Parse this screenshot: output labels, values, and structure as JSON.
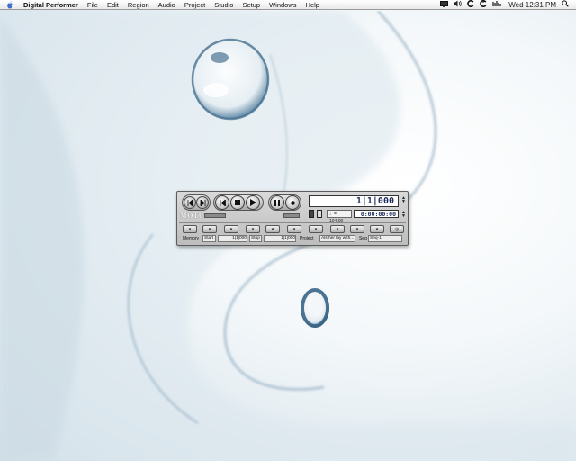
{
  "menubar": {
    "app_name": "Digital Performer",
    "items": [
      "File",
      "Edit",
      "Region",
      "Audio",
      "Project",
      "Studio",
      "Setup",
      "Windows",
      "Help"
    ],
    "tray": {
      "clock": "Wed 12:31 PM"
    }
  },
  "transport": {
    "logo": "MOTU",
    "counter": "1|1|000",
    "time": "0:00:00:00",
    "tempo": "♩= 104.00",
    "memory_label": "Memory",
    "memory_start_label": "Start",
    "memory_start_value": "1|1|000",
    "memory_stop_label": "Stop",
    "memory_stop_value": "1|1|000",
    "project_label": "Project",
    "project_value": "Alsther lay with...",
    "seq_label": "Seq",
    "seq_value": "Seq-1"
  },
  "colors": {
    "counter_text": "#1b2a5a",
    "wallpaper_stroke": "#3d6a8a"
  }
}
